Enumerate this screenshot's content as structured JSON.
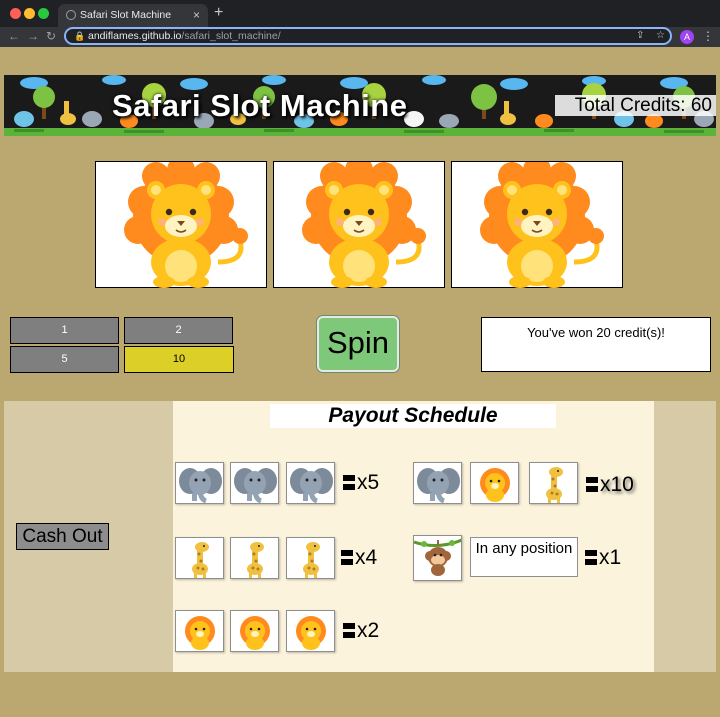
{
  "browser": {
    "tab_title": "Safari Slot Machine",
    "close_glyph": "×",
    "new_tab_glyph": "+",
    "url_domain": "andiflames.github.io",
    "url_path": "/safari_slot_machine/",
    "profile_initial": "A"
  },
  "header": {
    "title": "Safari Slot Machine",
    "credits_label": "Total Credits:",
    "credits_value": "60"
  },
  "reels": [
    "lion",
    "lion",
    "lion"
  ],
  "bets": {
    "options": [
      "1",
      "2",
      "5",
      "10"
    ],
    "selected": "10"
  },
  "spin_label": "Spin",
  "message": "You've won 20 credit(s)!",
  "cashout_label": "Cash Out",
  "payout": {
    "title": "Payout Schedule",
    "rows": [
      {
        "symbols": [
          "elephant",
          "elephant",
          "elephant"
        ],
        "multiplier": "x5"
      },
      {
        "symbols": [
          "elephant",
          "lion",
          "giraffe"
        ],
        "multiplier": "x10"
      },
      {
        "symbols": [
          "giraffe",
          "giraffe",
          "giraffe"
        ],
        "multiplier": "x4"
      },
      {
        "symbols": [
          "monkey"
        ],
        "note": "In any position",
        "multiplier": "x1"
      },
      {
        "symbols": [
          "lion",
          "lion",
          "lion"
        ],
        "multiplier": "x2"
      }
    ]
  },
  "colors": {
    "page_bg": "#bba871",
    "side_panel": "#d6cba6",
    "payout_bg": "#fcf3dd",
    "bet_button": "#7f7f7f",
    "bet_selected": "#dccf27",
    "spin_button": "#7ec87a"
  }
}
